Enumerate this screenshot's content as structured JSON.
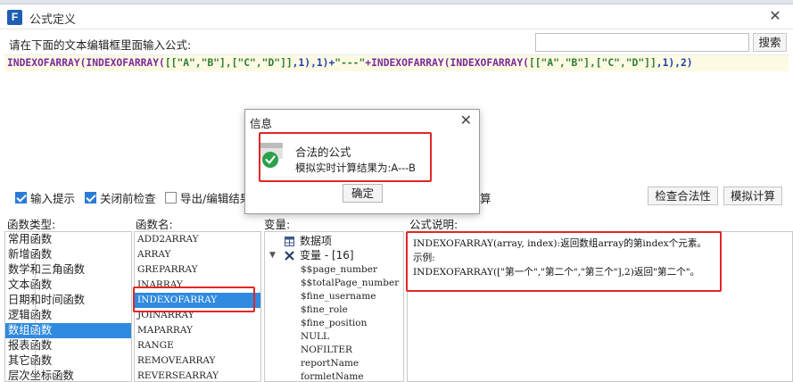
{
  "window": {
    "title": "公式定义",
    "logo_letter": "F"
  },
  "search": {
    "prompt": "请在下面的文本编辑框里面输入公式:",
    "value": "",
    "button_label": "搜索"
  },
  "editor": {
    "segments": [
      {
        "t": "INDEXOFARRAY(INDEXOFARRAY(",
        "c": "fn"
      },
      {
        "t": "[[\"A\",\"B\"],[\"C\",\"D\"]]",
        "c": "str"
      },
      {
        "t": ",1),1)+",
        "c": "plain"
      },
      {
        "t": "\"---\"",
        "c": "str"
      },
      {
        "t": "+INDEXOFARRAY(INDEXOFARRAY(",
        "c": "fn"
      },
      {
        "t": "[[\"A\",\"B\"],[\"C\",\"D\"]]",
        "c": "str"
      },
      {
        "t": ",1),2)",
        "c": "plain"
      }
    ]
  },
  "options": {
    "input_hint": {
      "label": "输入提示",
      "checked": true
    },
    "check_before_close": {
      "label": "关闭前检查",
      "checked": true
    },
    "export_edit": {
      "label": "导出/编辑结果",
      "checked": false
    },
    "hidden_suffix": "算",
    "validate_label": "检查合法性",
    "simulate_label": "模拟计算"
  },
  "categories": {
    "label": "函数类型:",
    "items": [
      "常用函数",
      "新增函数",
      "数学和三角函数",
      "文本函数",
      "日期和时间函数",
      "逻辑函数",
      "数组函数",
      "报表函数",
      "其它函数",
      "层次坐标函数"
    ],
    "selected": "数组函数"
  },
  "functions": {
    "label": "函数名:",
    "items": [
      "ADD2ARRAY",
      "ARRAY",
      "GREPARRAY",
      "INARRAY",
      "INDEXOFARRAY",
      "JOINARRAY",
      "MAPARRAY",
      "RANGE",
      "REMOVEARRAY",
      "REVERSEARRAY"
    ],
    "selected": "INDEXOFARRAY"
  },
  "variables": {
    "label": "变量:",
    "root": "数据项",
    "group": "变量 - [16]",
    "items": [
      "$$page_number",
      "$$totalPage_number",
      "$fine_username",
      "$fine_role",
      "$fine_position",
      "NULL",
      "NOFILTER",
      "reportName",
      "formletName"
    ]
  },
  "description": {
    "label": "公式说明:",
    "lines": [
      "INDEXOFARRAY(array, index):返回数组array的第index个元素。",
      "示例:",
      "INDEXOFARRAY([\"第一个\",\"第二个\",\"第三个\"],2)返回\"第二个\"。"
    ]
  },
  "dialog": {
    "title": "信息",
    "message": "合法的公式",
    "result": "模拟实时计算结果为:A---B",
    "ok_label": "确定",
    "icon": "success-check-icon",
    "icon_color": "#2aa14a"
  },
  "colors": {
    "selection": "#2f8ae0",
    "highlight": "#e32626",
    "editor_line": "#fdfae4"
  }
}
